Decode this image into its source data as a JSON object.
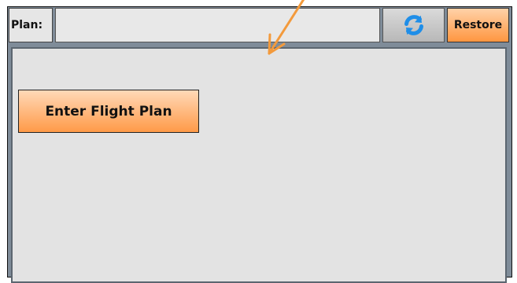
{
  "toolbar": {
    "plan_label": "Plan:",
    "plan_value": "",
    "refresh_icon": "refresh-icon",
    "restore_label": "Restore"
  },
  "main": {
    "enter_flight_plan_label": "Enter Flight Plan"
  },
  "annotation": {
    "arrow_icon": "annotation-arrow-icon",
    "arrow_color": "#f39a3c"
  },
  "colors": {
    "accent": "#ff9a48",
    "refresh_blue": "#1f8ee8"
  }
}
